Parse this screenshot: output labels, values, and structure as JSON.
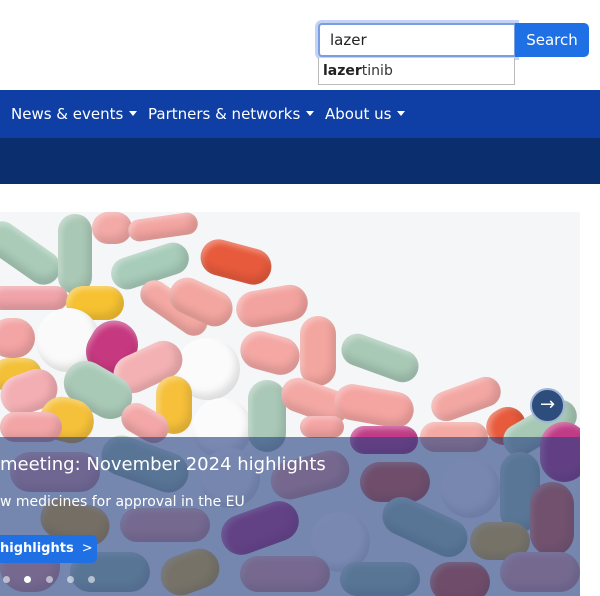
{
  "search": {
    "value": "lazer",
    "button_label": "Search",
    "suggestion_match": "lazer",
    "suggestion_rest": "tinib"
  },
  "nav": {
    "items": [
      {
        "label": "News & events"
      },
      {
        "label": "Partners & networks"
      },
      {
        "label": "About us"
      }
    ]
  },
  "hero": {
    "title": "meeting: November 2024 highlights",
    "subtitle": "w medicines for approval in the EU",
    "cta_label": "highlights",
    "cta_icon": "chevron-right-icon",
    "next_icon": "arrow-right-icon",
    "active_slide": 2,
    "slide_count": 5
  },
  "colors": {
    "nav": "#0f3fa5",
    "subnav": "#0b2f6e",
    "accent": "#1f6fe5"
  }
}
